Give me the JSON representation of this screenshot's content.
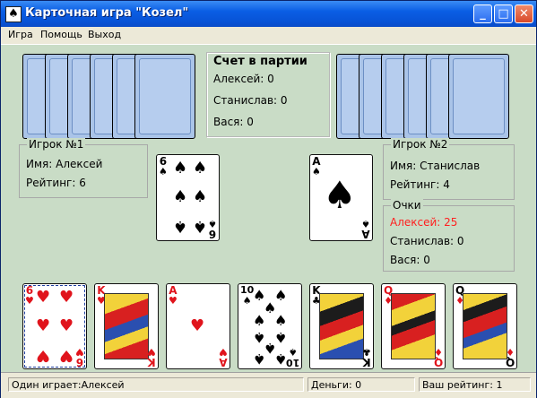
{
  "window": {
    "title": "Карточная игра \"Козел\"",
    "app_icon": "spade-icon"
  },
  "menu": {
    "items": [
      "Игра",
      "Помощь",
      "Выход"
    ]
  },
  "score_party": {
    "title": "Счет в партии",
    "rows": [
      "Алексей: 0",
      "Станислав: 0",
      "Вася: 0"
    ]
  },
  "player1": {
    "legend": "Игрок №1",
    "name": "Имя: Алексей",
    "rating": "Рейтинг: 6"
  },
  "player2": {
    "legend": "Игрок №2",
    "name": "Имя: Станислав",
    "rating": "Рейтинг: 4"
  },
  "points": {
    "legend": "Очки",
    "rows": [
      {
        "text": "Алексей: 25",
        "color": "#ff2020"
      },
      {
        "text": "Станислав: 0",
        "color": "#000000"
      },
      {
        "text": "Вася: 0",
        "color": "#000000"
      }
    ]
  },
  "played_cards": {
    "left": {
      "rank": "6",
      "suit": "♠"
    },
    "right": {
      "rank": "A",
      "suit": "♠"
    }
  },
  "hand": [
    {
      "rank": "6",
      "suit": "♥",
      "selected": true
    },
    {
      "rank": "K",
      "suit": "♥"
    },
    {
      "rank": "A",
      "suit": "♥"
    },
    {
      "rank": "10",
      "suit": "♠"
    },
    {
      "rank": "K",
      "suit": "♣"
    },
    {
      "rank": "Q",
      "suit": "♦"
    },
    {
      "rank": "Q",
      "suit": "♦"
    }
  ],
  "status": {
    "mode": "Один играет:Алексей",
    "money": "Деньги: 0",
    "rating": "Ваш рейтинг: 1"
  }
}
